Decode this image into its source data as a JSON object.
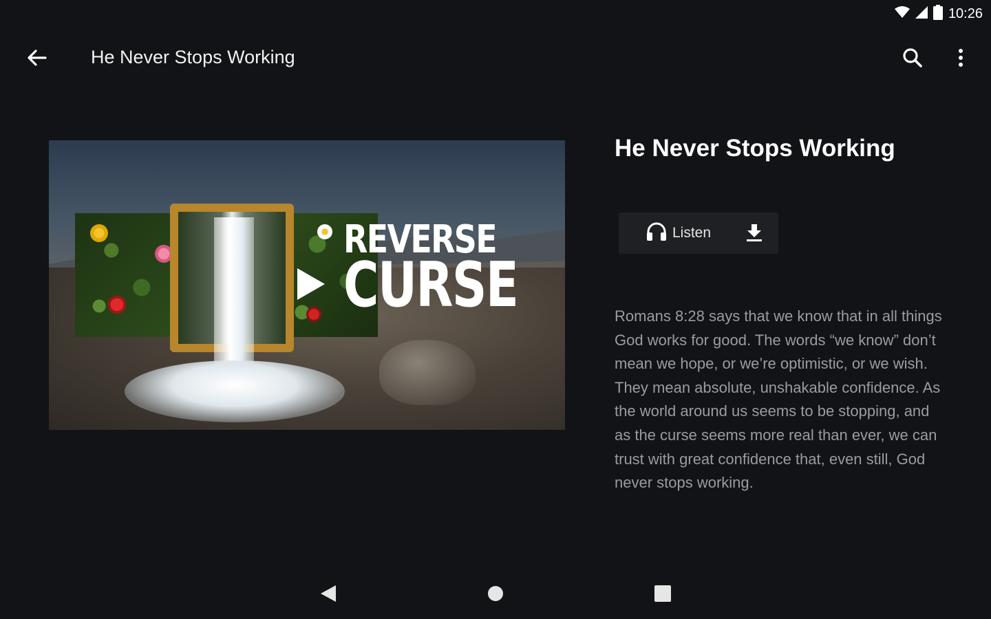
{
  "status_bar": {
    "time": "10:26",
    "icons": [
      "wifi-icon",
      "signal-icon",
      "battery-icon"
    ]
  },
  "app_bar": {
    "title": "He Never Stops Working",
    "icons": [
      "back-arrow-icon",
      "search-icon",
      "more-vert-icon"
    ]
  },
  "media": {
    "artwork_title_line1": "REVERSE",
    "artwork_title_line2": "CURSE",
    "play_icon": "play-icon"
  },
  "episode": {
    "title": "He Never Stops Working",
    "listen_label": "Listen",
    "listen_icon": "headphones-icon",
    "download_icon": "download-icon",
    "description": "Romans 8:28 says that we know that in all things God works for good. The words “we know” don’t mean we hope, or we’re optimistic, or we wish. They mean absolute, unshakable confidence. As the world around us seems to be stopping, and as the curse seems more real than ever, we can trust with great confidence that, even still, God never stops working."
  },
  "nav_bar": {
    "icons": [
      "nav-back-icon",
      "nav-home-icon",
      "nav-recents-icon"
    ]
  },
  "colors": {
    "background": "#121316",
    "surface": "#1f2023",
    "text_primary": "#ffffff",
    "text_secondary": "#9b9c9f",
    "frame_gold": "#b8862c"
  }
}
